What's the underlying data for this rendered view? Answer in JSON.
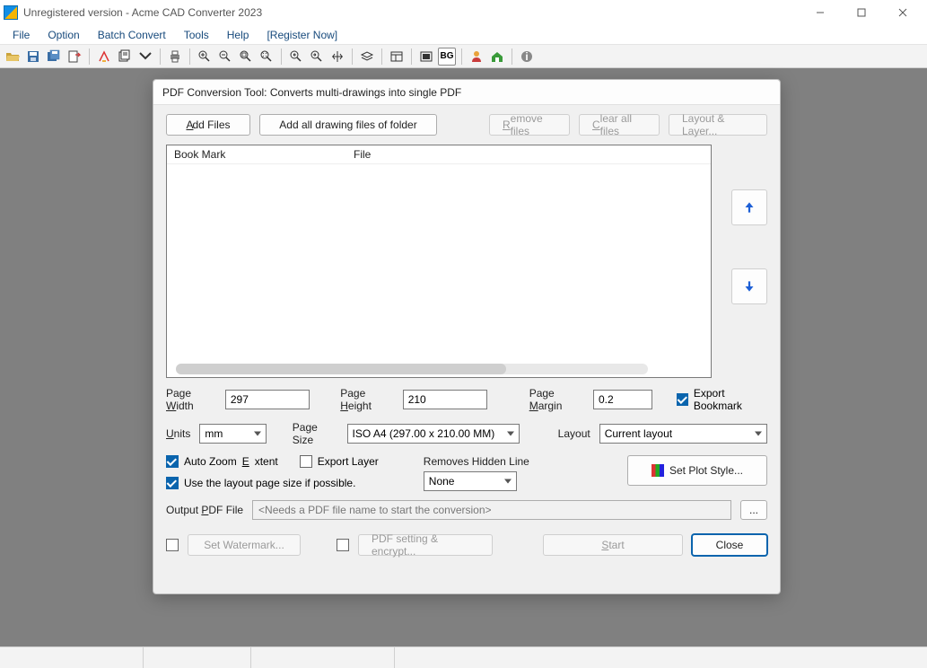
{
  "window": {
    "title": "Unregistered version - Acme CAD Converter 2023"
  },
  "menu": {
    "file": "File",
    "option": "Option",
    "batch": "Batch Convert",
    "tools": "Tools",
    "help": "Help",
    "register": "[Register Now]"
  },
  "dialog": {
    "title": "PDF Conversion Tool: Converts multi-drawings into single PDF",
    "add_files": "Add Files",
    "add_folder": "Add all drawing files of folder",
    "remove_files": "Remove files",
    "clear_all": "Clear all files",
    "layout_layer": "Layout & Layer...",
    "col_bookmark": "Book Mark",
    "col_file": "File",
    "page_width_label": "Page Width",
    "page_width_value": "297",
    "page_height_label": "Page Height",
    "page_height_value": "210",
    "page_margin_label": "Page Margin",
    "page_margin_value": "0.2",
    "export_bookmark": "Export Bookmark",
    "units_label": "Units",
    "units_value": "mm",
    "page_size_label": "Page Size",
    "page_size_value": "ISO A4 (297.00 x 210.00 MM)",
    "layout_label": "Layout",
    "layout_value": "Current layout",
    "auto_zoom": "Auto Zoom Extent",
    "export_layer": "Export Layer",
    "removes_hidden": "Removes Hidden Line",
    "hidden_value": "None",
    "use_layout_page": "Use the layout page size if possible.",
    "set_plot_style": "Set Plot Style...",
    "output_label": "Output PDF File",
    "output_placeholder": "<Needs a PDF file name to start the conversion>",
    "browse": "...",
    "set_watermark": "Set Watermark...",
    "pdf_setting": "PDF setting & encrypt...",
    "start": "Start",
    "close": "Close"
  }
}
